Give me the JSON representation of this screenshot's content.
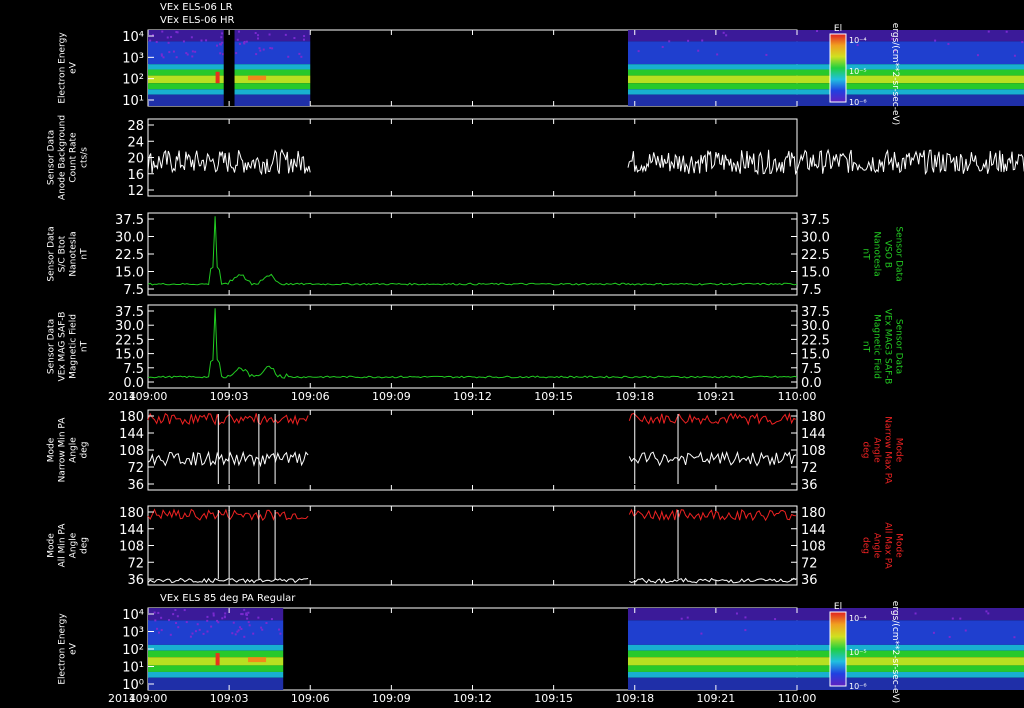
{
  "header_lines": [
    "VEx ELS-06 LR",
    "VEx ELS-06 HR"
  ],
  "footer": {
    "year": "2014"
  },
  "panel7_title": "VEx ELS 85 deg PA Regular",
  "colorbars": [
    {
      "title": "El",
      "ticks": [
        "10⁻⁴",
        "10⁻⁵",
        "10⁻⁶"
      ],
      "unit": "ergs/(cm**2-sr-sec-eV)"
    },
    {
      "title": "El",
      "ticks": [
        "10⁻⁴",
        "10⁻⁵",
        "10⁻⁶"
      ],
      "unit": "ergs/(cm**2-sr-sec-eV)"
    }
  ],
  "colors": {
    "white": "#ffffff",
    "green": "#22cc22",
    "red": "#ee2222"
  },
  "chart_data": [
    {
      "type": "heatmap",
      "id": "els-lr-hr",
      "ylabel_lines": [
        "Electron Energy",
        "eV"
      ],
      "yticks": [
        "10⁴",
        "10³",
        "10²",
        "10¹"
      ],
      "ylog": true,
      "ylim": [
        1,
        20000
      ],
      "data_intervals": [
        [
          "109:00",
          "109:06"
        ],
        [
          "109:17:45",
          "110:00"
        ]
      ],
      "note": "flux spectrogram"
    },
    {
      "type": "line",
      "id": "anode-bg",
      "ylabel_lines": [
        "Sensor Data",
        "Anode Background",
        "Count Rate",
        "cts/s"
      ],
      "yticks": [
        "28",
        "24",
        "20",
        "16",
        "12"
      ],
      "ylim": [
        10,
        28
      ],
      "series": [
        {
          "color": "white",
          "typical": 18,
          "noise": 2,
          "intervals": [
            [
              "109:00",
              "109:06"
            ],
            [
              "109:17:45",
              "110:00"
            ]
          ]
        }
      ]
    },
    {
      "type": "line",
      "id": "bmag-sc",
      "ylabel_lines": [
        "Sensor Data",
        "S/C Btot",
        "Nanotesla",
        "nT"
      ],
      "ylabel_right_lines": [
        "Sensor Data",
        "VSO B",
        "Nanotesla",
        "nT"
      ],
      "yticks": [
        "37.5",
        "30.0",
        "22.5",
        "15.0",
        "7.5"
      ],
      "ylim": [
        0,
        37.5
      ],
      "series": [
        {
          "color": "green",
          "baseline": 5,
          "spike_at": "109:02:30",
          "spike_value": 36
        }
      ]
    },
    {
      "type": "line",
      "id": "bmag-mag3",
      "ylabel_lines": [
        "Sensor Data",
        "VEx MAG SAF-B",
        "Magnetic Field",
        "nT"
      ],
      "ylabel_right_lines": [
        "Sensor Data",
        "VEx MAG3 SAF-B",
        "Magnetic Field",
        "nT"
      ],
      "yticks": [
        "37.5",
        "30.0",
        "22.5",
        "15.0",
        "7.5",
        "0.0"
      ],
      "ylim": [
        0,
        37.5
      ],
      "series": [
        {
          "color": "green",
          "baseline": 5,
          "spike_at": "109:02:30",
          "spike_value": 36
        }
      ]
    },
    {
      "type": "line",
      "id": "pa-narrow",
      "ylabel_lines": [
        "Mode",
        "Narrow Min PA",
        "Angle",
        "deg"
      ],
      "ylabel_right_lines": [
        "Mode",
        "Narrow Max PA",
        "Angle",
        "deg"
      ],
      "yticks": [
        "180",
        "144",
        "108",
        "72",
        "36"
      ],
      "ylim": [
        0,
        180
      ],
      "series": [
        {
          "color": "white",
          "label": "Min PA"
        },
        {
          "color": "red",
          "label": "Max PA"
        }
      ]
    },
    {
      "type": "line",
      "id": "pa-all",
      "ylabel_lines": [
        "Mode",
        "All Min PA",
        "Angle",
        "deg"
      ],
      "ylabel_right_lines": [
        "Mode",
        "All Max PA",
        "Angle",
        "deg"
      ],
      "yticks": [
        "180",
        "144",
        "108",
        "72",
        "36"
      ],
      "ylim": [
        0,
        180
      ],
      "series": [
        {
          "color": "white",
          "label": "Min PA"
        },
        {
          "color": "red",
          "label": "Max PA"
        }
      ]
    },
    {
      "type": "heatmap",
      "id": "els-85deg",
      "ylabel_lines": [
        "Electron Energy",
        "eV"
      ],
      "yticks": [
        "10⁴",
        "10³",
        "10²",
        "10¹",
        "10⁰"
      ],
      "ylog": true,
      "ylim": [
        0.5,
        20000
      ],
      "data_intervals": [
        [
          "109:00",
          "109:05"
        ],
        [
          "109:17:45",
          "110:00"
        ]
      ]
    }
  ],
  "xaxis": {
    "ticks": [
      "109:00",
      "109:03",
      "109:06",
      "109:09",
      "109:12",
      "109:15",
      "109:18",
      "109:21",
      "110:00"
    ],
    "minutes": [
      0,
      3,
      6,
      9,
      12,
      15,
      18,
      21,
      24
    ]
  }
}
